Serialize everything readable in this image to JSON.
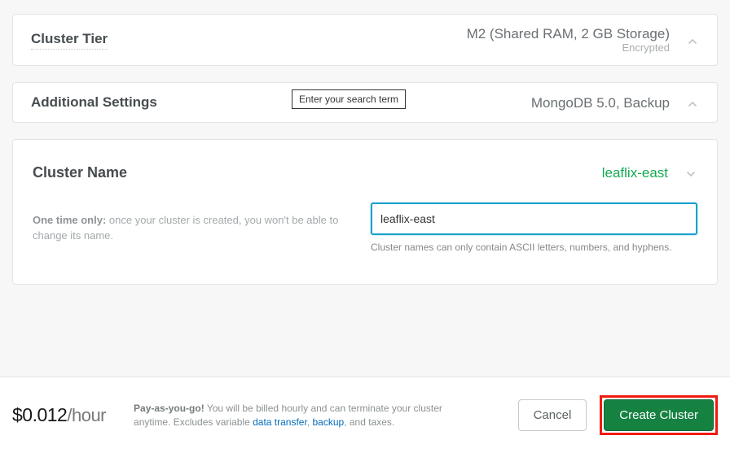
{
  "sections": {
    "tier": {
      "title": "Cluster Tier",
      "value": "M2 (Shared RAM, 2 GB Storage)",
      "sub": "Encrypted"
    },
    "additional": {
      "title": "Additional Settings",
      "value": "MongoDB 5.0, Backup"
    },
    "name": {
      "title": "Cluster Name",
      "current": "leaflix-east",
      "hint_strong": "One time only:",
      "hint_rest": " once your cluster is created, you won't be able to change its name.",
      "input_value": "leaflix-east",
      "helper": "Cluster names can only contain ASCII letters, numbers, and hyphens."
    }
  },
  "search_tooltip": "Enter your search term",
  "footer": {
    "price_value": "$0.012",
    "price_unit": "/hour",
    "desc_strong": "Pay-as-you-go!",
    "desc_1": " You will be billed hourly and can terminate your cluster anytime. Excludes variable ",
    "link_data_transfer": "data transfer",
    "desc_sep": ", ",
    "link_backup": "backup",
    "desc_tail": ", and taxes.",
    "cancel": "Cancel",
    "create": "Create Cluster"
  }
}
